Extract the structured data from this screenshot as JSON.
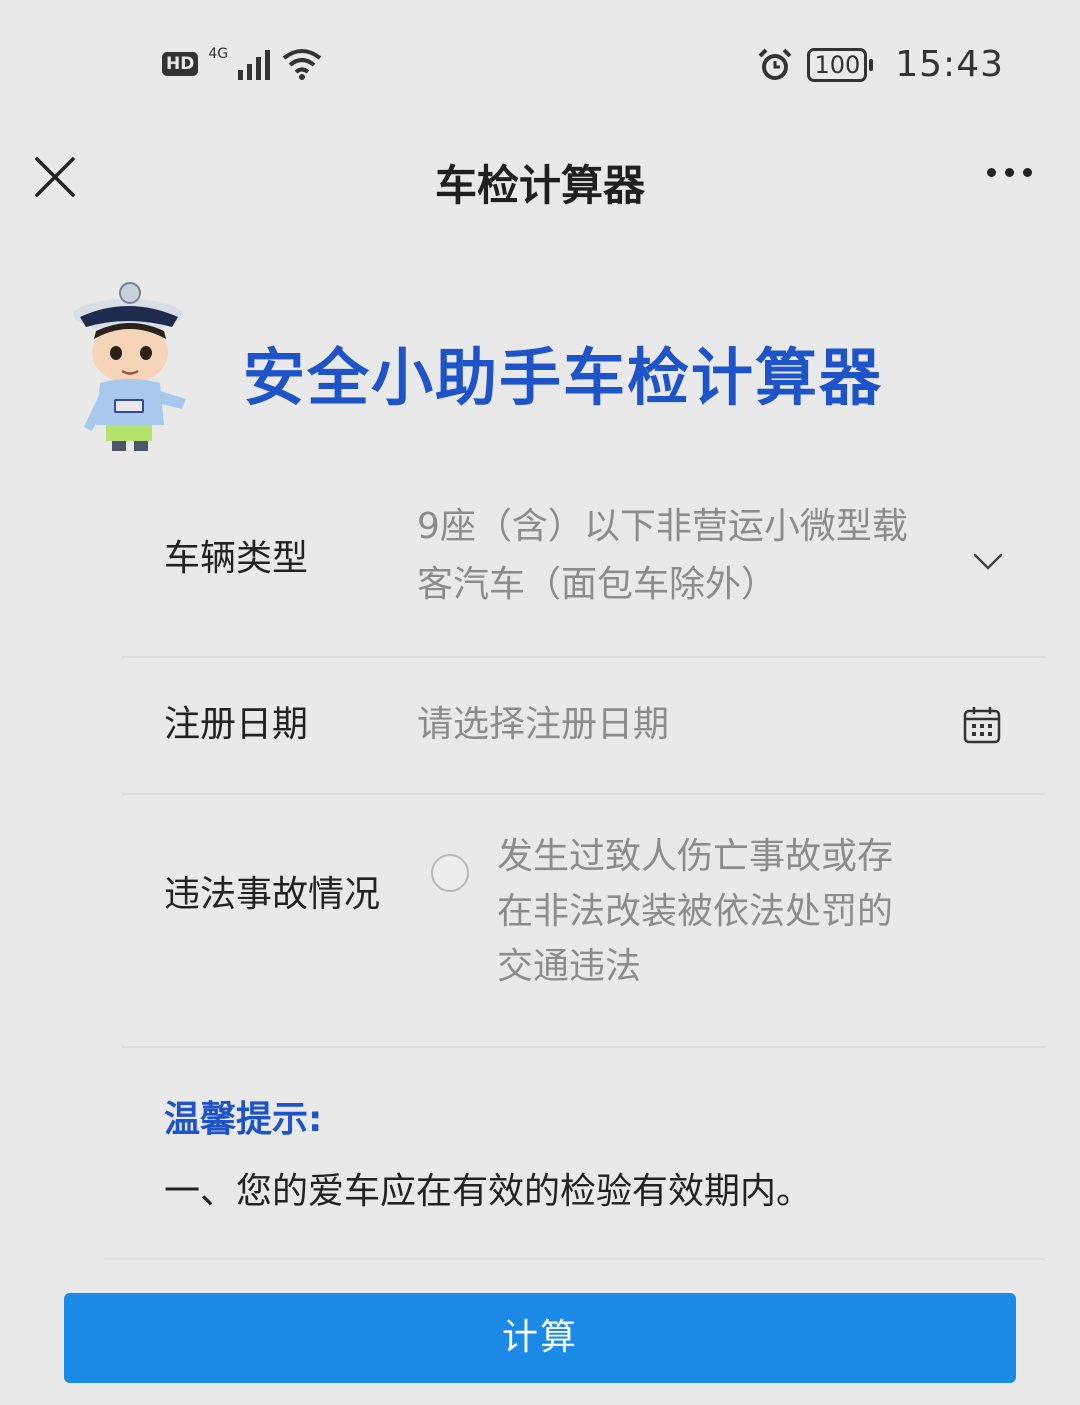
{
  "status_bar": {
    "hd": "HD",
    "network": "4G",
    "battery": "100",
    "time": "15:43",
    "icons": [
      "signal-icon",
      "wifi-icon",
      "alarm-icon",
      "battery-icon"
    ]
  },
  "nav": {
    "title": "车检计算器",
    "close_icon": "close-icon",
    "more_icon": "more-icon"
  },
  "banner": {
    "title": "安全小助手车检计算器",
    "mascot": "police-mascot"
  },
  "form": {
    "vehicle_type": {
      "label": "车辆类型",
      "value": "9座（含）以下非营运小微型载客汽车（面包车除外）",
      "icon": "chevron-down-icon"
    },
    "register_date": {
      "label": "注册日期",
      "placeholder": "请选择注册日期",
      "icon": "calendar-icon"
    },
    "violation": {
      "label": "违法事故情况",
      "option": "发生过致人伤亡事故或存在非法改装被依法处罚的交通违法",
      "checked": false
    }
  },
  "tips": {
    "title": "温馨提示:",
    "line1": "一、您的爱车应在有效的检验有效期内。"
  },
  "button": {
    "label": "计算"
  },
  "colors": {
    "accent_blue": "#1f54c9",
    "button_blue": "#1a8ae6",
    "background": "#e9e9ea"
  }
}
